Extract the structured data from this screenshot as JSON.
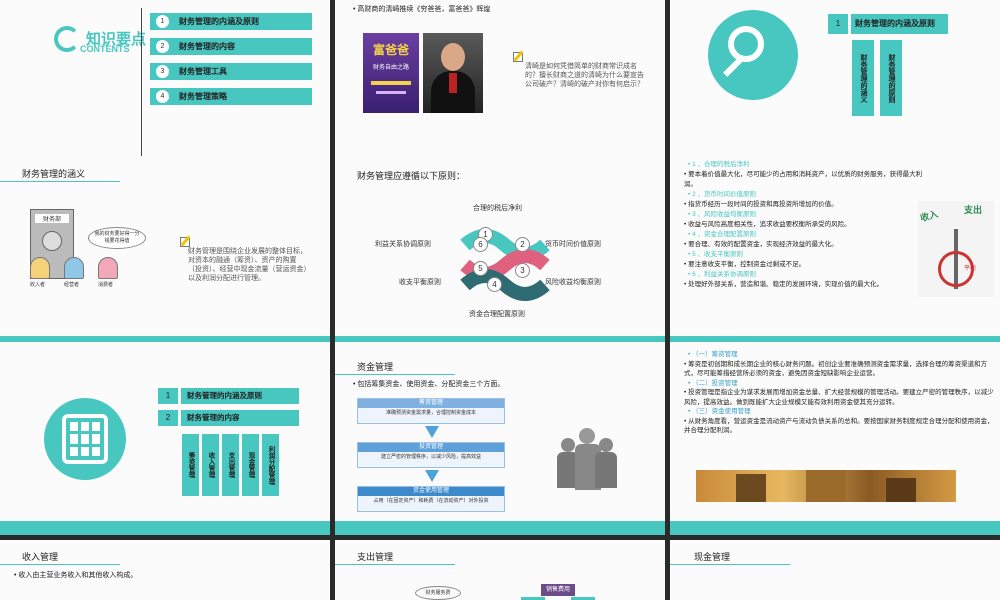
{
  "slides": {
    "s1": {
      "logo_text": "知识要点",
      "logo_sub": "CONTENTS",
      "items": [
        {
          "num": "1",
          "label": "财务管理的内涵及原则"
        },
        {
          "num": "2",
          "label": "财务管理的内容"
        },
        {
          "num": "3",
          "label": "财务管理工具"
        },
        {
          "num": "4",
          "label": "财务管理策略"
        }
      ]
    },
    "s2": {
      "bullet": "高财商的清崎推续《穷爸爸，富爸爸》辉煌",
      "book_title": "富爸爸",
      "book_sub": "财务自由之路",
      "note": "清崎是如何凭借简单的财商常识成名的？擅长财商之道的清崎为什么要宣告公司破产？清崎的破产对你有何启示？"
    },
    "s3": {
      "num": "1",
      "title": "财务管理的内涵及原则",
      "col1": "财务管理的涵义",
      "col2": "财务管理的原则"
    },
    "s4": {
      "title": "财务管理的涵义",
      "speech": "我的财务要好得一分钱要花得值",
      "labels": [
        "收入者",
        "经营者",
        "消费者"
      ],
      "safe_label": "财务部",
      "desc": "财务管理是围绕企业发展的整体目标，对资本的融通（筹资）、资产的购置（投资）、经营中现金流量（营运资金）以及利润分配进行管理。"
    },
    "s5": {
      "title": "财务管理应遵循以下原则：",
      "principles": [
        {
          "num": "1",
          "label": "合理的税后净利"
        },
        {
          "num": "2",
          "label": "货币时间价值原则"
        },
        {
          "num": "3",
          "label": "风险收益均衡原则"
        },
        {
          "num": "4",
          "label": "资金合理配置原则"
        },
        {
          "num": "5",
          "label": "收支平衡原则"
        },
        {
          "num": "6",
          "label": "利益关系协调原则"
        }
      ]
    },
    "s6": {
      "lines": [
        {
          "type": "h",
          "text": "1 、合理的税后净利"
        },
        {
          "type": "b",
          "text": "要本着价值最大化，尽可能少的占用和消耗资产，以优质的财务服务，获得最大利润。"
        },
        {
          "type": "h",
          "text": "2 、货币时间价值原则"
        },
        {
          "type": "b",
          "text": "指货币经历一段时间的投资和再投资所增加的价值。"
        },
        {
          "type": "h",
          "text": "3 、风险收益均衡原则"
        },
        {
          "type": "b",
          "text": "收益与风险高度相关性，追求收益要权衡所承受的风险。"
        },
        {
          "type": "h",
          "text": "4 、资金合理配置原则"
        },
        {
          "type": "b",
          "text": "要合理、有效的配置资金，实现经济效益的最大化。"
        },
        {
          "type": "h",
          "text": "5 、收支平衡原则"
        },
        {
          "type": "b",
          "text": "要注意收支平衡，控制资金过剩或不足。"
        },
        {
          "type": "h",
          "text": "6 、利益关系协调原则"
        },
        {
          "type": "b",
          "text": "处理好外部关系，营造和谐、稳定的发展环境，实现价值的最大化。"
        }
      ],
      "img_labels": [
        "收入",
        "支出",
        "平衡"
      ]
    },
    "s7": {
      "items": [
        {
          "num": "1",
          "label": "财务管理的内涵及原则"
        },
        {
          "num": "2",
          "label": "财务管理的内容"
        }
      ],
      "cols": [
        "筹资管理",
        "收入管理",
        "支出管理",
        "现金管理",
        "利润分配管理"
      ]
    },
    "s8": {
      "title": "资金管理",
      "bullet": "包括筹集资金、使用资金、分配资金三个方面。",
      "boxes": [
        {
          "head": "筹资管理",
          "body": "准确预测资金需求量，合理控制资金成本"
        },
        {
          "head": "投资管理",
          "body": "建立严密的管理秩序，以减少风险，提高效益"
        },
        {
          "head": "资金使用管理",
          "body": "占用（在固定资产）和耗费（在流动资产）对外投资"
        }
      ]
    },
    "s9": {
      "lines": [
        {
          "type": "h",
          "text": "（一）筹资管理"
        },
        {
          "type": "b",
          "text": "筹资是初创期和成长期企业的核心财务问题。初创企业要准确预测资金需求量，选择合理的筹资渠道和方式，尽可能筹措经营所必须的资金，避免因资金短缺影响企业运营。"
        },
        {
          "type": "h",
          "text": "（二）投资管理"
        },
        {
          "type": "b",
          "text": "投资管理是指企业为谋求发展而增加资金总量、扩大经营规模的管理活动。要建立严密的管理秩序，以减少风险，提高效益。做到既能扩大企业规模又能有效利用资金使其充分运转。"
        },
        {
          "type": "h",
          "text": "（三）资金使用管理"
        },
        {
          "type": "b",
          "text": "从财务角度看，营运资金是流动资产与流动负债关系的总和。要按国家财务制度规定合理分配和使用资金，并合理分配利润。"
        }
      ]
    },
    "s10": {
      "title": "收入管理",
      "bullet": "收入由主营业务收入和其他收入构成。"
    },
    "s11": {
      "title": "支出管理",
      "bubble": "财务服务费",
      "node": "销售费用"
    },
    "s12": {
      "title": "现金管理"
    }
  }
}
